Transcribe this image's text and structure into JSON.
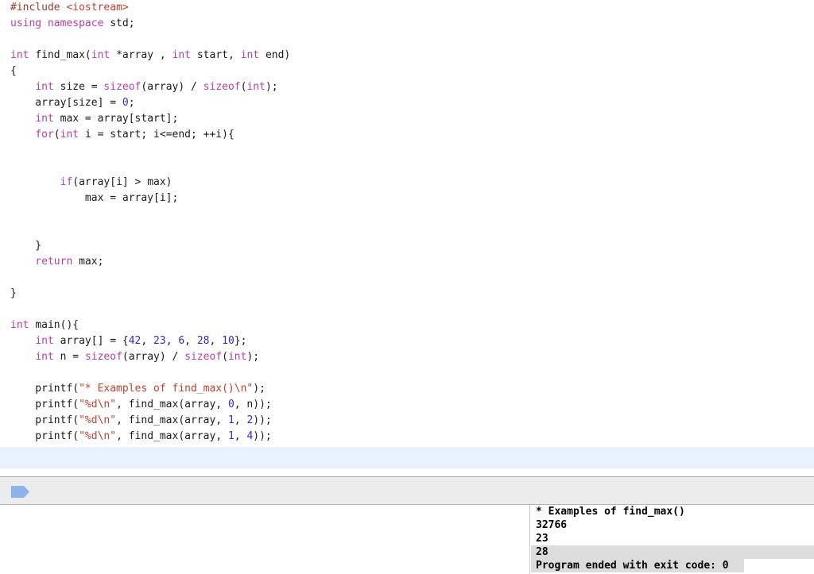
{
  "editor": {
    "language": "cpp",
    "highlighted_line_index": 28,
    "code_lines": [
      [
        {
          "t": "#include ",
          "c": "pre"
        },
        {
          "t": "<iostream>",
          "c": "hdr"
        }
      ],
      [
        {
          "t": "using namespace ",
          "c": "kw"
        },
        {
          "t": "std;",
          "c": "plain"
        }
      ],
      [],
      [
        {
          "t": "int ",
          "c": "kw"
        },
        {
          "t": "find_max(",
          "c": "plain"
        },
        {
          "t": "int ",
          "c": "kw"
        },
        {
          "t": "*array , ",
          "c": "plain"
        },
        {
          "t": "int ",
          "c": "kw"
        },
        {
          "t": "start, ",
          "c": "plain"
        },
        {
          "t": "int ",
          "c": "kw"
        },
        {
          "t": "end)",
          "c": "plain"
        }
      ],
      [
        {
          "t": "{",
          "c": "plain"
        }
      ],
      [
        {
          "t": "    ",
          "c": "plain"
        },
        {
          "t": "int ",
          "c": "kw"
        },
        {
          "t": "size = ",
          "c": "plain"
        },
        {
          "t": "sizeof",
          "c": "kw"
        },
        {
          "t": "(array) / ",
          "c": "plain"
        },
        {
          "t": "sizeof",
          "c": "kw"
        },
        {
          "t": "(",
          "c": "plain"
        },
        {
          "t": "int",
          "c": "kw"
        },
        {
          "t": ");",
          "c": "plain"
        }
      ],
      [
        {
          "t": "    array[size] = ",
          "c": "plain"
        },
        {
          "t": "0",
          "c": "num"
        },
        {
          "t": ";",
          "c": "plain"
        }
      ],
      [
        {
          "t": "    ",
          "c": "plain"
        },
        {
          "t": "int ",
          "c": "kw"
        },
        {
          "t": "max = array[start];",
          "c": "plain"
        }
      ],
      [
        {
          "t": "    ",
          "c": "plain"
        },
        {
          "t": "for",
          "c": "kw"
        },
        {
          "t": "(",
          "c": "plain"
        },
        {
          "t": "int ",
          "c": "kw"
        },
        {
          "t": "i = start; i<=end; ++i){",
          "c": "plain"
        }
      ],
      [],
      [],
      [
        {
          "t": "        ",
          "c": "plain"
        },
        {
          "t": "if",
          "c": "kw"
        },
        {
          "t": "(array[i] > max)",
          "c": "plain"
        }
      ],
      [
        {
          "t": "            max = array[i];",
          "c": "plain"
        }
      ],
      [],
      [],
      [
        {
          "t": "    }",
          "c": "plain"
        }
      ],
      [
        {
          "t": "    ",
          "c": "plain"
        },
        {
          "t": "return ",
          "c": "kw"
        },
        {
          "t": "max;",
          "c": "plain"
        }
      ],
      [],
      [
        {
          "t": "}",
          "c": "plain"
        }
      ],
      [],
      [
        {
          "t": "int ",
          "c": "kw"
        },
        {
          "t": "main(){",
          "c": "plain"
        }
      ],
      [
        {
          "t": "    ",
          "c": "plain"
        },
        {
          "t": "int ",
          "c": "kw"
        },
        {
          "t": "array[] = {",
          "c": "plain"
        },
        {
          "t": "42",
          "c": "num"
        },
        {
          "t": ", ",
          "c": "plain"
        },
        {
          "t": "23",
          "c": "num"
        },
        {
          "t": ", ",
          "c": "plain"
        },
        {
          "t": "6",
          "c": "num"
        },
        {
          "t": ", ",
          "c": "plain"
        },
        {
          "t": "28",
          "c": "num"
        },
        {
          "t": ", ",
          "c": "plain"
        },
        {
          "t": "10",
          "c": "num"
        },
        {
          "t": "};",
          "c": "plain"
        }
      ],
      [
        {
          "t": "    ",
          "c": "plain"
        },
        {
          "t": "int ",
          "c": "kw"
        },
        {
          "t": "n = ",
          "c": "plain"
        },
        {
          "t": "sizeof",
          "c": "kw"
        },
        {
          "t": "(array) / ",
          "c": "plain"
        },
        {
          "t": "sizeof",
          "c": "kw"
        },
        {
          "t": "(",
          "c": "plain"
        },
        {
          "t": "int",
          "c": "kw"
        },
        {
          "t": ");",
          "c": "plain"
        }
      ],
      [],
      [
        {
          "t": "    printf(",
          "c": "plain"
        },
        {
          "t": "\"* Examples of find_max()\\n\"",
          "c": "str"
        },
        {
          "t": ");",
          "c": "plain"
        }
      ],
      [
        {
          "t": "    printf(",
          "c": "plain"
        },
        {
          "t": "\"%d\\n\"",
          "c": "str"
        },
        {
          "t": ", find_max(array, ",
          "c": "plain"
        },
        {
          "t": "0",
          "c": "num"
        },
        {
          "t": ", n));",
          "c": "plain"
        }
      ],
      [
        {
          "t": "    printf(",
          "c": "plain"
        },
        {
          "t": "\"%d\\n\"",
          "c": "str"
        },
        {
          "t": ", find_max(array, ",
          "c": "plain"
        },
        {
          "t": "1",
          "c": "num"
        },
        {
          "t": ", ",
          "c": "plain"
        },
        {
          "t": "2",
          "c": "num"
        },
        {
          "t": "));",
          "c": "plain"
        }
      ],
      [
        {
          "t": "    printf(",
          "c": "plain"
        },
        {
          "t": "\"%d\\n\"",
          "c": "str"
        },
        {
          "t": ", find_max(array, ",
          "c": "plain"
        },
        {
          "t": "1",
          "c": "num"
        },
        {
          "t": ", ",
          "c": "plain"
        },
        {
          "t": "4",
          "c": "num"
        },
        {
          "t": "));",
          "c": "plain"
        }
      ]
    ]
  },
  "debug_bar": {
    "breakpoint_icon": "breakpoint-tag-icon",
    "breakpoint_color": "#8cb4ec"
  },
  "variables_pane": {
    "content": ""
  },
  "console": {
    "lines": [
      {
        "text": "* Examples of find_max()",
        "selected": "none"
      },
      {
        "text": "32766",
        "selected": "none"
      },
      {
        "text": "23",
        "selected": "none"
      },
      {
        "text": "28",
        "selected": "full"
      },
      {
        "text": "Program ended with exit code: 0",
        "selected": "partial"
      }
    ]
  },
  "colors": {
    "background": "#ffffff",
    "preprocessor": "#9a3a2a",
    "header": "#c2402c",
    "keyword": "#b23fa8",
    "plain": "#1a1a1a",
    "number": "#2b2bd4",
    "string": "#c2402c",
    "current_line": "#eaf1fe",
    "toolbar": "#ececec",
    "selection": "#dcdcdc"
  }
}
